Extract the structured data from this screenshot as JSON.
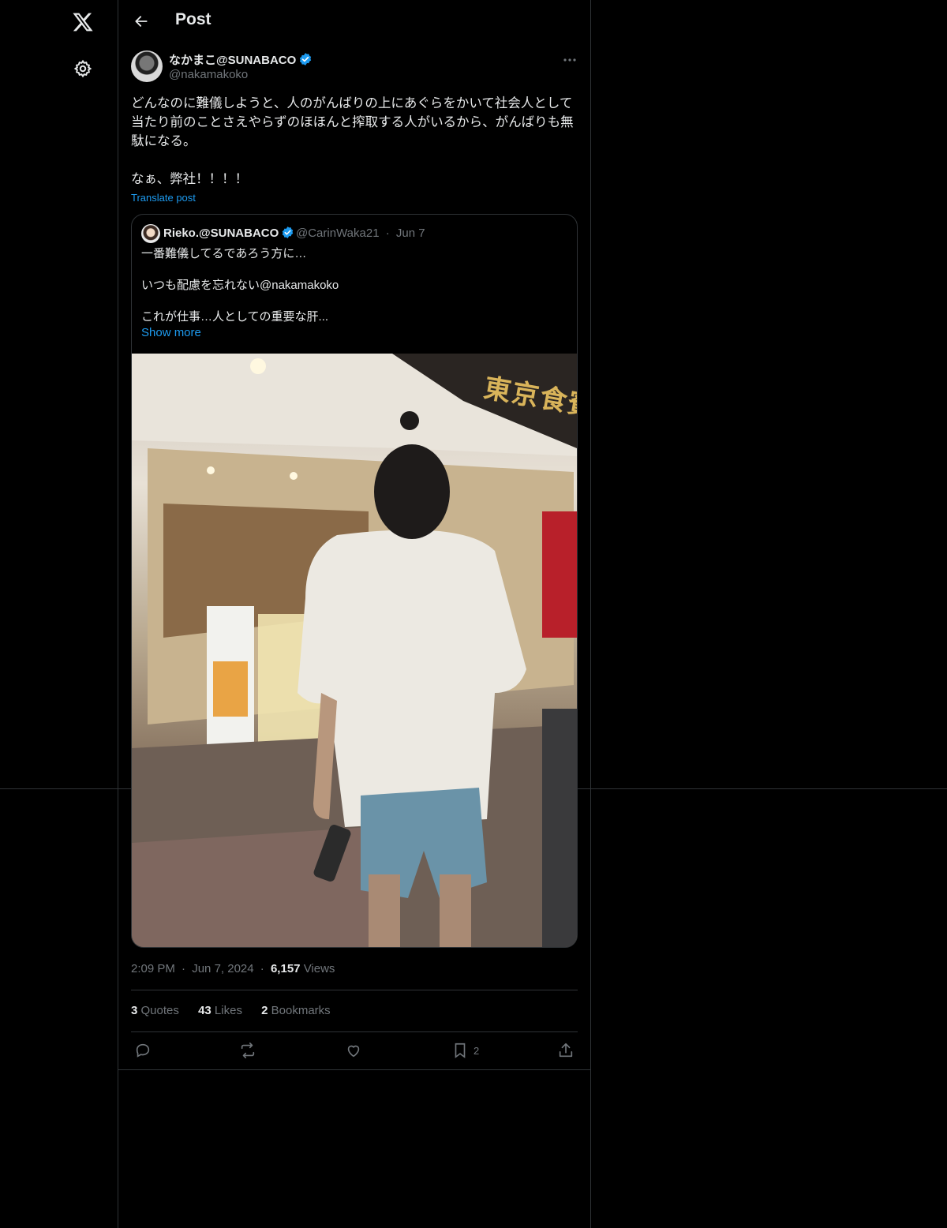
{
  "header": {
    "title": "Post"
  },
  "post": {
    "author_name": "なかまこ@SUNABACO",
    "author_handle": "@nakamakoko",
    "text": "どんなのに難儀しようと、人のがんばりの上にあぐらをかいて社会人として当たり前のことさえやらずのほほんと搾取する人がいるから、がんばりも無駄になる。\n\nなぁ、弊社！！！！",
    "translate_label": "Translate post",
    "time": "2:09 PM",
    "date": "Jun 7, 2024",
    "views_count": "6,157",
    "views_label": "Views"
  },
  "quote": {
    "author_name": "Rieko.@SUNABACO",
    "author_handle": "@CarinWaka21",
    "date": "Jun 7",
    "text": "一番難儀してるであろう方に…\n\nいつも配慮を忘れない@nakamakoko\n\nこれが仕事…人としての重要な肝...",
    "show_more": "Show more",
    "photo_sign": "東京食賓"
  },
  "stats": {
    "quotes_count": "3",
    "quotes_label": "Quotes",
    "likes_count": "43",
    "likes_label": "Likes",
    "bookmarks_count": "2",
    "bookmarks_label": "Bookmarks"
  },
  "actions": {
    "bookmark_count": "2"
  },
  "icons": [
    "x-logo-icon",
    "gear-icon",
    "back-arrow-icon",
    "verified-badge-icon",
    "more-icon",
    "reply-icon",
    "repost-icon",
    "like-icon",
    "bookmark-icon",
    "share-icon"
  ],
  "colors": {
    "background": "#000000",
    "accent": "#1d9bf0",
    "text": "#e7e9ea",
    "muted": "#71767b",
    "border": "#2f3336"
  }
}
